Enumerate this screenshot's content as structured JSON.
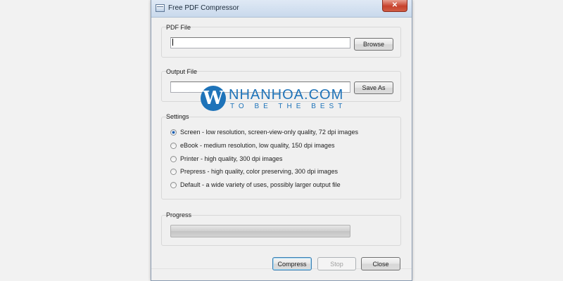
{
  "window": {
    "title": "Free PDF Compressor",
    "close_glyph": "✕"
  },
  "pdf_file": {
    "label": "PDF File",
    "value": "",
    "browse_label": "Browse"
  },
  "output_file": {
    "label": "Output File",
    "value": "",
    "save_as_label": "Save As"
  },
  "settings": {
    "label": "Settings",
    "selected_index": 0,
    "options": [
      {
        "label": "Screen - low resolution, screen-view-only quality, 72 dpi images"
      },
      {
        "label": "eBook - medium resolution, low quality, 150 dpi images"
      },
      {
        "label": "Printer - high quality, 300 dpi images"
      },
      {
        "label": "Prepress - high quality, color preserving, 300 dpi images"
      },
      {
        "label": "Default - a wide variety of uses, possibly larger output file"
      }
    ]
  },
  "progress": {
    "label": "Progress",
    "value": 0
  },
  "buttons": {
    "compress": "Compress",
    "stop": "Stop",
    "close": "Close"
  },
  "watermark": {
    "logo_letter": "W",
    "brand": "NHANHOA.COM",
    "slogan": "TO BE THE BEST",
    "color": "#1e73b9"
  },
  "colors": {
    "title_bar": "#c9d9ec",
    "close_button": "#c7412c",
    "radio_dot": "#1a5ba8"
  }
}
